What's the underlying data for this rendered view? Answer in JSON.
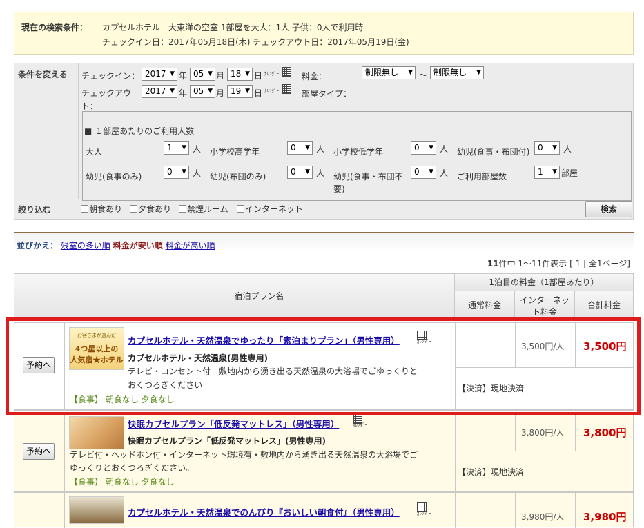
{
  "conditions": {
    "label": "現在の検索条件：",
    "line1": "カプセルホテル　大東洋の空室 1部屋を大人：1人 子供：0人で利用時",
    "line2": "チェックイン日：2017年05月18日(木) チェックアウト日：2017年05月19日(金)"
  },
  "form": {
    "change_label": "条件を変える",
    "checkin_label": "チェックイン：",
    "checkout_label": "チェックアウ",
    "checkout_label2": "ト：",
    "checkin": {
      "year": "2017",
      "month": "05",
      "day": "18"
    },
    "checkout": {
      "year": "2017",
      "month": "05",
      "day": "19"
    },
    "year_unit": "年",
    "month_unit": "月",
    "day_unit": "日",
    "calendar_text": "ｶﾚﾝﾀﾞｰ",
    "price_label": "料金：",
    "price_min": "制限無し",
    "price_sep": "～",
    "price_max": "制限無し",
    "room_type_label": "部屋タイプ：",
    "people_title": "■ １部屋あたりのご利用人数",
    "people": [
      {
        "label": "大人",
        "value": "1"
      },
      {
        "label": "小学校高学年",
        "value": "0"
      },
      {
        "label": "小学校低学年",
        "value": "0"
      },
      {
        "label": "幼児(食事・布団付)",
        "value": "0"
      },
      {
        "label": "幼児(食事のみ)",
        "value": "0"
      },
      {
        "label": "幼児(布団のみ)",
        "value": "0"
      },
      {
        "label": "幼児(食事・布団不",
        "label2": "要)",
        "value": "0"
      },
      {
        "label": "ご利用部屋数",
        "value": "1"
      }
    ],
    "person_unit": "人",
    "room_unit": "部屋",
    "filter_label": "絞り込む",
    "filters": [
      "朝食あり",
      "夕食あり",
      "禁煙ルーム",
      "インターネット"
    ],
    "search_button": "検索"
  },
  "sort": {
    "label": "並びかえ：",
    "opt1": "残室の多い順",
    "opt2": "料金が安い順",
    "opt3": "料金が高い順"
  },
  "count": {
    "total": "11",
    "text": "件中 1～11件表示 [ 1 | 全1ページ]"
  },
  "table": {
    "col_plan": "宿泊プラン名",
    "col_price_group": "1泊目の料金（1部屋あたり）",
    "col_normal": "通常料金",
    "col_internet": "インターネット料金",
    "col_total": "合計料金"
  },
  "plans": [
    {
      "reserve": "予約へ",
      "title": "カプセルホテル・天然温泉でゆったり「素泊まりプラン」（男性専用）",
      "subtitle": "カプセルホテル・天然温泉(男性専用)",
      "desc1": "テレビ・コンセント付　敷地内から湧き出る天然温泉の大浴場でごゆっくりと",
      "desc2": "おくつろぎください",
      "meal": "【食事】 朝食なし 夕食なし",
      "internet_price": "3,500円/人",
      "total": "3,500円",
      "payment": "【決済】現地決済",
      "thumb_top": "お客さまが選んだ",
      "thumb_main": "4つ星以上の",
      "thumb_main2": "人気宿★ホテル"
    },
    {
      "reserve": "予約へ",
      "title": "快眠カプセルプラン「低反発マットレス」（男性専用）",
      "subtitle": "快眠カプセルプラン「低反発マットレス」(男性専用)",
      "desc1": "テレビ付・ヘッドホン付・インターネット環境有・敷地内から湧き出る天然温泉の大浴場でご",
      "desc2": "ゆっくりとおくつろぎください。",
      "meal": "【食事】 朝食なし 夕食なし",
      "internet_price": "3,800円/人",
      "total": "3,800円",
      "payment": "【決済】現地決済"
    },
    {
      "title": "カプセルホテル・天然温泉でのんびり『おいしい朝食付』（男性専用）",
      "internet_price": "3,980円/人",
      "total": "3,980円"
    }
  ],
  "colors": {
    "accent_red": "#cc0000",
    "highlight_border": "#e01b1b",
    "meal_green": "#5a8b1a",
    "link_blue": "#1a0dab"
  }
}
